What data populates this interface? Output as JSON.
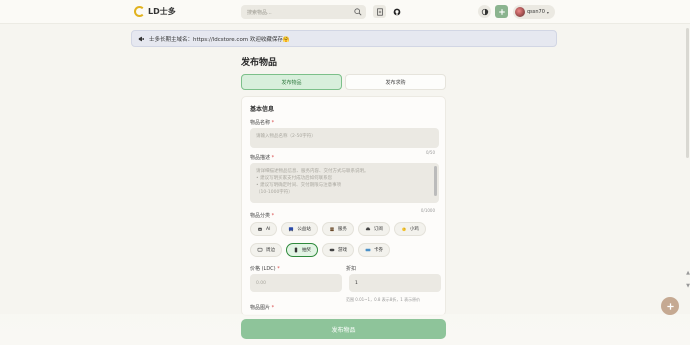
{
  "header": {
    "brand": "LD士多",
    "search_placeholder": "搜索物品...",
    "username": "qssn70"
  },
  "notice": {
    "text": "士多长期主域名：https://ldcstore.com 欢迎收藏保存🤗"
  },
  "page": {
    "title": "发布物品",
    "tabs": [
      "发布物品",
      "发布求购"
    ]
  },
  "form": {
    "section_title": "基本信息",
    "name_label": "物品名称",
    "name_placeholder": "请输入物品名称（2-50字符）",
    "name_counter": "0/50",
    "desc_label": "物品描述",
    "desc_placeholder_lines": [
      "请详细描述物品信息、服务内容、交付方式与联系说明。",
      "• 建议写明买家支付成功后如何联系您",
      "• 建议写明确定时间、交付期限与注意事项",
      "",
      "（10-1000字符）"
    ],
    "desc_counter": "0/1000",
    "category_label": "物品分类",
    "categories_row1": [
      {
        "label": "AI",
        "icon": "robot-icon"
      },
      {
        "label": "公益站",
        "icon": "bus-icon"
      },
      {
        "label": "服务",
        "icon": "people-icon"
      },
      {
        "label": "订阅",
        "icon": "car-icon"
      },
      {
        "label": "小鸡",
        "icon": "chick-icon"
      }
    ],
    "categories_row2": [
      {
        "label": "周边",
        "icon": "chat-icon"
      },
      {
        "label": "抽奖",
        "icon": "phone-icon",
        "selected": true
      },
      {
        "label": "游戏",
        "icon": "gamepad-icon"
      },
      {
        "label": "卡券",
        "icon": "ticket-icon"
      }
    ],
    "price_label": "价格 (LDC)",
    "price_placeholder": "0.00",
    "discount_label": "折扣",
    "discount_value": "1",
    "discount_hint": "范围 0.01~1，0.8 表示8折，1 表示原价",
    "images_label": "物品图片"
  },
  "submit_label": "发布物品",
  "colors": {
    "accent": "#8ec49a",
    "tab_active_bg": "#d8efdc",
    "required": "#d84848"
  }
}
